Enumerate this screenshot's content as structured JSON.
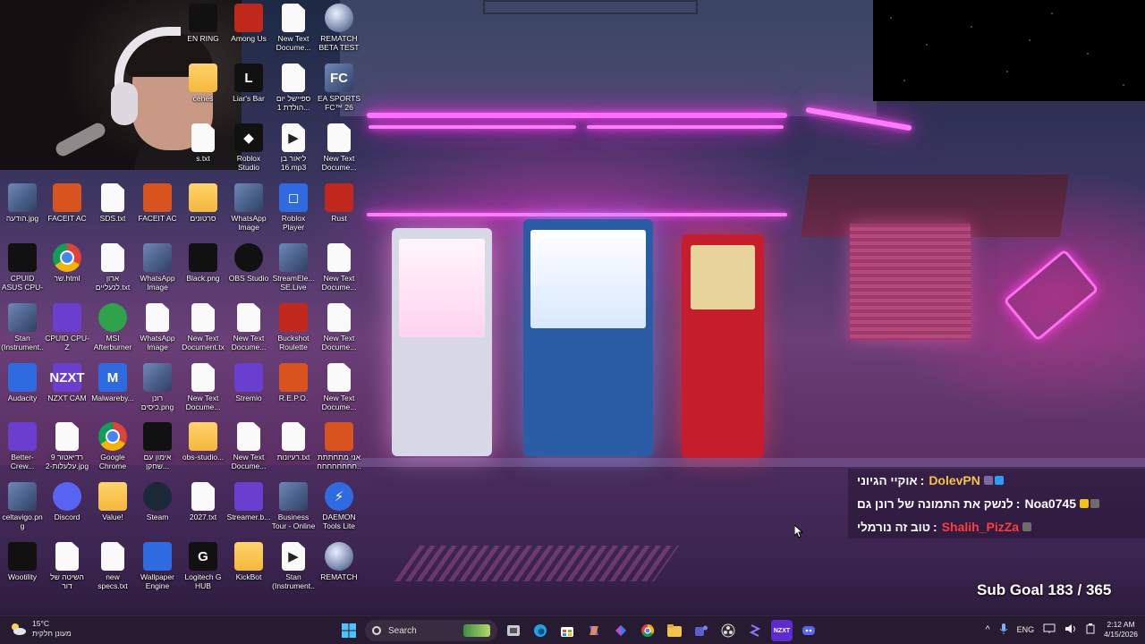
{
  "desktop_icons": [
    {
      "col": 0,
      "row": 0,
      "label": "EN RING",
      "glyph": "",
      "style": "g-dark"
    },
    {
      "col": 1,
      "row": 0,
      "label": "Among Us",
      "glyph": "",
      "style": "g-red"
    },
    {
      "col": 2,
      "row": 0,
      "label": "New Text Docume...",
      "glyph": "",
      "style": "g-doc"
    },
    {
      "col": 3,
      "row": 0,
      "label": "REMATCH BETA TEST",
      "glyph": "",
      "style": "g-rematch"
    },
    {
      "col": 0,
      "row": 1,
      "label": "cenes",
      "glyph": "",
      "style": "g-folder"
    },
    {
      "col": 1,
      "row": 1,
      "label": "Liar's Bar",
      "glyph": "L",
      "style": "g-dark"
    },
    {
      "col": 2,
      "row": 1,
      "label": "ספיישל יום הולדת 1...",
      "glyph": "",
      "style": "g-doc"
    },
    {
      "col": 3,
      "row": 1,
      "label": "EA SPORTS FC™ 26",
      "glyph": "FC",
      "style": "g-img"
    },
    {
      "col": 0,
      "row": 2,
      "label": "s.txt",
      "glyph": "",
      "style": "g-doc"
    },
    {
      "col": 1,
      "row": 2,
      "label": "Roblox Studio",
      "glyph": "◆",
      "style": "g-dark"
    },
    {
      "col": 2,
      "row": 2,
      "label": "ליאור בן 16.mp3",
      "glyph": "▶",
      "style": "g-mp3"
    },
    {
      "col": 3,
      "row": 2,
      "label": "New Text Docume...",
      "glyph": "",
      "style": "g-doc"
    },
    {
      "col": -4,
      "row": 3,
      "label": "הודעה.jpg",
      "glyph": "",
      "style": "g-img"
    },
    {
      "col": -3,
      "row": 3,
      "label": "FACEIT AC",
      "glyph": "",
      "style": "g-orange"
    },
    {
      "col": -2,
      "row": 3,
      "label": "SDS.txt",
      "glyph": "",
      "style": "g-doc"
    },
    {
      "col": -1,
      "row": 3,
      "label": "FACEIT AC",
      "glyph": "",
      "style": "g-orange"
    },
    {
      "col": 0,
      "row": 3,
      "label": "סרטונים",
      "glyph": "",
      "style": "g-folder"
    },
    {
      "col": 1,
      "row": 3,
      "label": "WhatsApp Image 2026...",
      "glyph": "",
      "style": "g-img"
    },
    {
      "col": 2,
      "row": 3,
      "label": "Roblox Player",
      "glyph": "◻",
      "style": "g-blue"
    },
    {
      "col": 3,
      "row": 3,
      "label": "Rust",
      "glyph": "",
      "style": "g-red"
    },
    {
      "col": -4,
      "row": 4,
      "label": "CPUID ASUS CPU-Z",
      "glyph": "",
      "style": "g-dark"
    },
    {
      "col": -3,
      "row": 4,
      "label": "שר.html",
      "glyph": "",
      "style": "g-chrome"
    },
    {
      "col": -2,
      "row": 4,
      "label": "ארון לנעליים.txt",
      "glyph": "",
      "style": "g-doc"
    },
    {
      "col": -1,
      "row": 4,
      "label": "WhatsApp Image 2025...",
      "glyph": "",
      "style": "g-img"
    },
    {
      "col": 0,
      "row": 4,
      "label": "Black.png",
      "glyph": "",
      "style": "g-dark"
    },
    {
      "col": 1,
      "row": 4,
      "label": "OBS Studio",
      "glyph": "",
      "style": "g-circle g-dark"
    },
    {
      "col": 2,
      "row": 4,
      "label": "StreamEle... SE.Live",
      "glyph": "",
      "style": "g-img"
    },
    {
      "col": 3,
      "row": 4,
      "label": "New Text Docume...",
      "glyph": "",
      "style": "g-doc"
    },
    {
      "col": -4,
      "row": 5,
      "label": "Stan (Instrument...",
      "glyph": "",
      "style": "g-img"
    },
    {
      "col": -3,
      "row": 5,
      "label": "CPUID CPU-Z",
      "glyph": "",
      "style": "g-purple"
    },
    {
      "col": -2,
      "row": 5,
      "label": "MSI Afterburner",
      "glyph": "",
      "style": "g-circle g-green"
    },
    {
      "col": -1,
      "row": 5,
      "label": "WhatsApp Image 2025...",
      "glyph": "",
      "style": "g-doc"
    },
    {
      "col": 0,
      "row": 5,
      "label": "New Text Document.txt",
      "glyph": "",
      "style": "g-doc"
    },
    {
      "col": 1,
      "row": 5,
      "label": "New Text Docume...",
      "glyph": "",
      "style": "g-doc"
    },
    {
      "col": 2,
      "row": 5,
      "label": "Buckshot Roulette",
      "glyph": "",
      "style": "g-red"
    },
    {
      "col": 3,
      "row": 5,
      "label": "New Text Docume...",
      "glyph": "",
      "style": "g-doc"
    },
    {
      "col": -4,
      "row": 6,
      "label": "Audacity",
      "glyph": "",
      "style": "g-blue"
    },
    {
      "col": -3,
      "row": 6,
      "label": "NZXT CAM",
      "glyph": "NZXT",
      "style": "g-purple"
    },
    {
      "col": -2,
      "row": 6,
      "label": "Malwareby...",
      "glyph": "M",
      "style": "g-blue"
    },
    {
      "col": -1,
      "row": 6,
      "label": "רונן כיסים.png",
      "glyph": "",
      "style": "g-img"
    },
    {
      "col": 0,
      "row": 6,
      "label": "New Text Docume...",
      "glyph": "",
      "style": "g-doc"
    },
    {
      "col": 1,
      "row": 6,
      "label": "Stremio",
      "glyph": "",
      "style": "g-purple"
    },
    {
      "col": 2,
      "row": 6,
      "label": "R.E.P.O.",
      "glyph": "",
      "style": "g-orange"
    },
    {
      "col": 3,
      "row": 6,
      "label": "New Text Docume...",
      "glyph": "",
      "style": "g-doc"
    },
    {
      "col": -4,
      "row": 7,
      "label": "Better-Crew...",
      "glyph": "",
      "style": "g-purple"
    },
    {
      "col": -3,
      "row": 7,
      "label": "רדיאטור 9 עלעלות-2.jpg",
      "glyph": "",
      "style": "g-doc"
    },
    {
      "col": -2,
      "row": 7,
      "label": "Google Chrome",
      "glyph": "",
      "style": "g-chrome"
    },
    {
      "col": -1,
      "row": 7,
      "label": "אימון עם שחקן...",
      "glyph": "",
      "style": "g-dark"
    },
    {
      "col": 0,
      "row": 7,
      "label": "obs-studio...",
      "glyph": "",
      "style": "g-folder"
    },
    {
      "col": 1,
      "row": 7,
      "label": "New Text Docume...",
      "glyph": "",
      "style": "g-doc"
    },
    {
      "col": 2,
      "row": 7,
      "label": "רעיונות.txt",
      "glyph": "",
      "style": "g-doc"
    },
    {
      "col": 3,
      "row": 7,
      "label": "אני מתחתתת חחחחחחחח...",
      "glyph": "",
      "style": "g-orange"
    },
    {
      "col": -4,
      "row": 8,
      "label": "celtavigo.png",
      "glyph": "",
      "style": "g-img"
    },
    {
      "col": -3,
      "row": 8,
      "label": "Discord",
      "glyph": "",
      "style": "g-disc"
    },
    {
      "col": -2,
      "row": 8,
      "label": "Value!",
      "glyph": "",
      "style": "g-folder"
    },
    {
      "col": -1,
      "row": 8,
      "label": "Steam",
      "glyph": "",
      "style": "g-steam"
    },
    {
      "col": 0,
      "row": 8,
      "label": "2027.txt",
      "glyph": "",
      "style": "g-doc"
    },
    {
      "col": 1,
      "row": 8,
      "label": "Streamer.b...",
      "glyph": "",
      "style": "g-purple"
    },
    {
      "col": 2,
      "row": 8,
      "label": "Business Tour - Online M...",
      "glyph": "",
      "style": "g-img"
    },
    {
      "col": 3,
      "row": 8,
      "label": "DAEMON Tools Lite",
      "glyph": "⚡",
      "style": "g-circle g-blue"
    },
    {
      "col": -4,
      "row": 9,
      "label": "Wootility",
      "glyph": "",
      "style": "g-dark"
    },
    {
      "col": -3,
      "row": 9,
      "label": "השיטה של דור בגדול.png",
      "glyph": "",
      "style": "g-doc"
    },
    {
      "col": -2,
      "row": 9,
      "label": "new specs.txt",
      "glyph": "",
      "style": "g-doc"
    },
    {
      "col": -1,
      "row": 9,
      "label": "Wallpaper Engine",
      "glyph": "",
      "style": "g-blue"
    },
    {
      "col": 0,
      "row": 9,
      "label": "Logitech G HUB",
      "glyph": "G",
      "style": "g-dark"
    },
    {
      "col": 1,
      "row": 9,
      "label": "KickBot",
      "glyph": "",
      "style": "g-folder"
    },
    {
      "col": 2,
      "row": 9,
      "label": "Stan (Instrument...",
      "glyph": "▶",
      "style": "g-mp3"
    },
    {
      "col": 3,
      "row": 9,
      "label": "REMATCH",
      "glyph": "",
      "style": "g-rematch"
    }
  ],
  "chat": [
    {
      "user": "DolevPN",
      "user_color": "#f6c343",
      "message": "אוקיי הגיוני",
      "badges": [
        "#2c9cff",
        "#7a6aa0"
      ]
    },
    {
      "user": "Noa0745",
      "user_color": "#ffffff",
      "message": "לנשק את התמונה של רונן גם",
      "badges": [
        "#6d6d6d",
        "#f1c40f"
      ]
    },
    {
      "user": "Shalih_PizZa",
      "user_color": "#ff3b3b",
      "message": "טוב זה נורמלי",
      "badges": [
        "#6d6d6d"
      ]
    }
  ],
  "sub_goal": {
    "label": "Sub Goal",
    "current": "183",
    "sep": "/",
    "target": "365"
  },
  "taskbar": {
    "weather_temp": "15°C",
    "weather_desc": "מעונן חלקית",
    "search_placeholder": "Search",
    "lang": "ENG",
    "time": "2:12 AM",
    "date": "4/15/2026",
    "tray_up_arrow": "^"
  }
}
